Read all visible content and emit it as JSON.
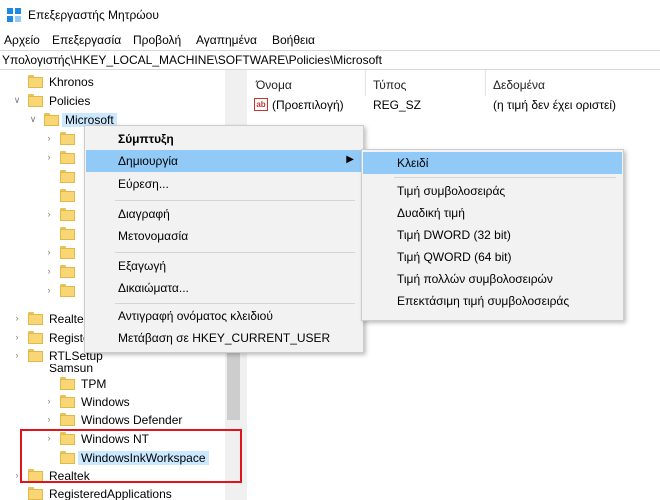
{
  "window": {
    "title": "Επεξεργαστής Μητρώου"
  },
  "menubar": [
    "Αρχείο",
    "Επεξεργασία",
    "Προβολή",
    "Αγαπημένα",
    "Βοήθεια"
  ],
  "address": "Υπολογιστής\\HKEY_LOCAL_MACHINE\\SOFTWARE\\Policies\\Microsoft",
  "tree": {
    "khronos": "Khronos",
    "policies": "Policies",
    "microsoft": "Microsoft",
    "realtek_partial": "Realtel",
    "registered_partial": "Registe",
    "rtlsetup": "RTLSetup",
    "samsung_partial": "Samsun",
    "tpm": "TPM",
    "windows": "Windows",
    "windows_defender": "Windows Defender",
    "windows_nt": "Windows NT",
    "windows_ink": "WindowsInkWorkspace",
    "realtek": "Realtek",
    "registered_apps": "RegisteredApplications"
  },
  "values": {
    "headers": {
      "name": "Όνομα",
      "type": "Τύπος",
      "data": "Δεδομένα"
    },
    "rows": [
      {
        "icon": "ab",
        "name": "(Προεπιλογή)",
        "type": "REG_SZ",
        "data": "(η τιμή δεν έχει οριστεί)"
      }
    ]
  },
  "context_menu": {
    "collapse": "Σύμπτυξη",
    "new": "Δημιουργία",
    "find": "Εύρεση...",
    "delete": "Διαγραφή",
    "rename": "Μετονομασία",
    "export": "Εξαγωγή",
    "permissions": "Δικαιώματα...",
    "copy_key_name": "Αντιγραφή ονόματος κλειδιού",
    "goto_hkcu": "Μετάβαση σε HKEY_CURRENT_USER"
  },
  "submenu": {
    "key": "Κλειδί",
    "string_value": "Τιμή συμβολοσειράς",
    "binary_value": "Δυαδική τιμή",
    "dword_value": "Τιμή DWORD (32 bit)",
    "qword_value": "Τιμή QWORD (64 bit)",
    "multi_string_value": "Τιμή πολλών συμβολοσειρών",
    "expandable_string_value": "Επεκτάσιμη τιμή συμβολοσειράς"
  },
  "colors": {
    "highlight": "#91c9f7",
    "selection": "#cce8ff",
    "annotation": "#e0141b"
  }
}
